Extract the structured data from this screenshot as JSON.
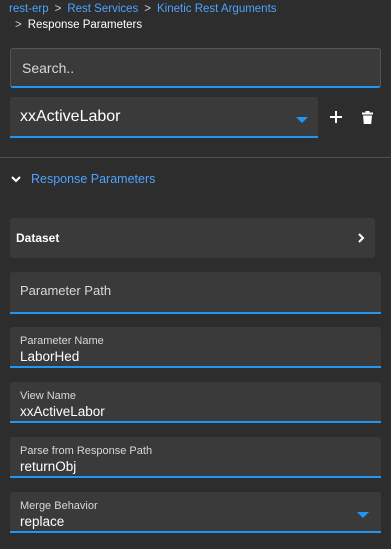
{
  "breadcrumb": {
    "items": [
      "rest-erp",
      "Rest Services",
      "Kinetic Rest Arguments"
    ],
    "separator": ">",
    "current": "Response Parameters"
  },
  "search": {
    "placeholder": "Search.."
  },
  "selector": {
    "value": "xxActiveLabor"
  },
  "section": {
    "title": "Response Parameters",
    "expanded": true
  },
  "dataset": {
    "label": "Dataset"
  },
  "fields": {
    "parameter_path": {
      "label": "Parameter Path",
      "value": ""
    },
    "parameter_name": {
      "label": "Parameter Name",
      "value": "LaborHed"
    },
    "view_name": {
      "label": "View Name",
      "value": "xxActiveLabor"
    },
    "parse_path": {
      "label": "Parse from Response Path",
      "value": "returnObj"
    },
    "merge_behavior": {
      "label": "Merge Behavior",
      "value": "replace"
    }
  },
  "icons": {
    "add": "plus-icon",
    "delete": "trash-icon",
    "dropdown": "caret-down-icon",
    "section": "chevron-down-icon",
    "dataset": "chevron-right-icon"
  },
  "colors": {
    "accent": "#2196f3",
    "link": "#4da3ff",
    "background": "#2d2d2d",
    "panel": "#3a3a3a"
  }
}
